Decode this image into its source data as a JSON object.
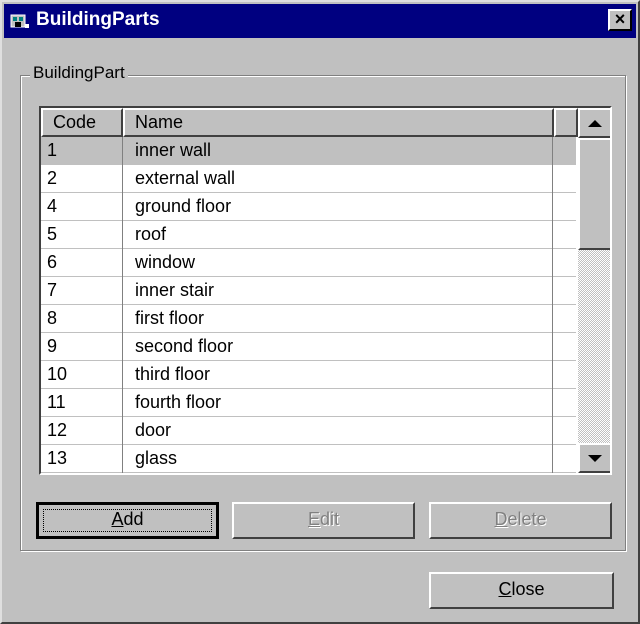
{
  "window": {
    "title": "BuildingParts"
  },
  "group": {
    "label": "BuildingPart"
  },
  "grid": {
    "columns": [
      "Code",
      "Name"
    ],
    "rows": [
      {
        "code": "1",
        "name": "inner wall"
      },
      {
        "code": "2",
        "name": "external wall"
      },
      {
        "code": "4",
        "name": "ground floor"
      },
      {
        "code": "5",
        "name": "roof"
      },
      {
        "code": "6",
        "name": "window"
      },
      {
        "code": "7",
        "name": "inner stair"
      },
      {
        "code": "8",
        "name": "first floor"
      },
      {
        "code": "9",
        "name": "second floor"
      },
      {
        "code": "10",
        "name": "third floor"
      },
      {
        "code": "11",
        "name": "fourth floor"
      },
      {
        "code": "12",
        "name": "door"
      },
      {
        "code": "13",
        "name": "glass"
      }
    ],
    "selected_index": 0
  },
  "buttons": {
    "add": {
      "first": "A",
      "rest": "dd"
    },
    "edit": {
      "first": "E",
      "rest": "dit"
    },
    "delete": {
      "first": "D",
      "rest": "elete"
    },
    "close": {
      "first": "C",
      "rest": "lose"
    }
  },
  "icons": {
    "app": "building-app-icon",
    "close": "close-icon",
    "scroll_up": "arrow-up-icon",
    "scroll_down": "arrow-down-icon"
  },
  "colors": {
    "titlebar": "#000080",
    "face": "#c0c0c0",
    "disabled_text": "#808080"
  }
}
